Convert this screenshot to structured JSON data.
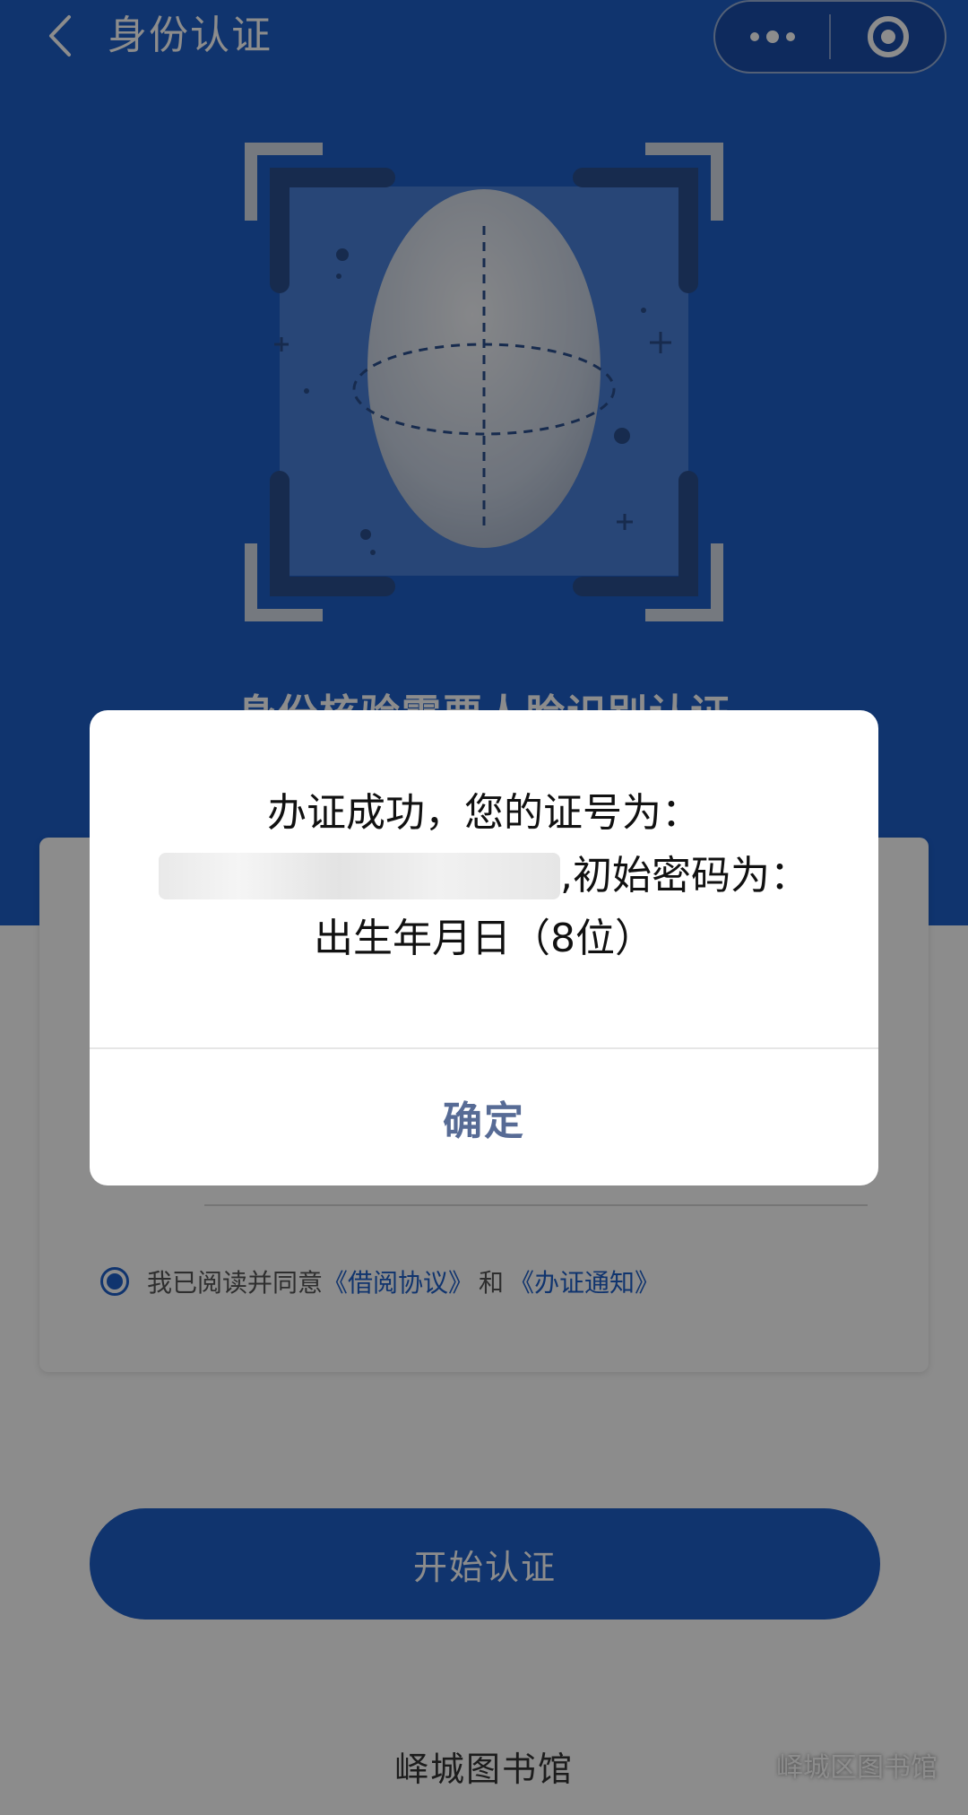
{
  "nav": {
    "title": "身份认证"
  },
  "hero": {
    "subtitle": "身份核验需要人脸识别认证"
  },
  "agreement": {
    "prefix": "我已阅读并同意",
    "link1": "《借阅协议》",
    "and": "和",
    "link2": "《办证通知》",
    "checked": true
  },
  "start_button": "开始认证",
  "footer": {
    "library_name": "峄城图书馆",
    "watermark": "峄城区图书馆"
  },
  "dialog": {
    "line1": "办证成功，您的证号为：",
    "card_number": "",
    "line2_suffix": ",初始密码为：",
    "line3": "出生年月日（8位）",
    "confirm": "确定"
  },
  "colors": {
    "primary_blue": "#1e5fc9",
    "dialog_button": "#576b95"
  },
  "icons": {
    "back": "chevron-left-icon",
    "more": "more-dots-icon",
    "close_miniprogram": "target-circle-icon",
    "wechat": "wechat-icon"
  }
}
